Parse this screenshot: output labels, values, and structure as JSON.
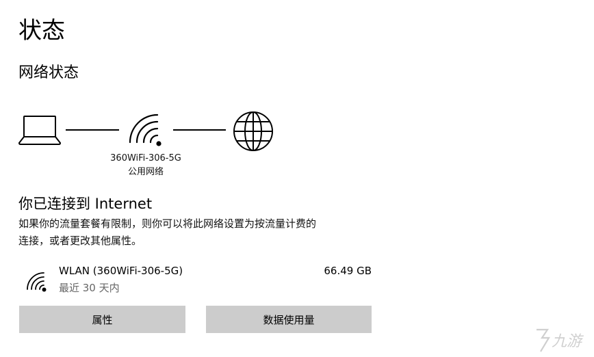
{
  "page": {
    "title": "状态",
    "section_title": "网络状态"
  },
  "diagram": {
    "network_name": "360WiFi-306-5G",
    "network_type": "公用网络",
    "icons": [
      "laptop-icon",
      "wifi-icon",
      "globe-icon"
    ]
  },
  "connection": {
    "title": "你已连接到 Internet",
    "description_line1": "如果你的流量套餐有限制，则你可以将此网络设置为按流量计费的",
    "description_line2": "连接，或者更改其他属性。"
  },
  "adapter": {
    "name": "WLAN (360WiFi-306-5G)",
    "period": "最近 30 天内",
    "usage": "66.49 GB",
    "icon": "wifi-icon"
  },
  "buttons": {
    "properties": "属性",
    "data_usage": "数据使用量"
  },
  "watermark": {
    "text": "九游",
    "icon": "logo-icon"
  }
}
